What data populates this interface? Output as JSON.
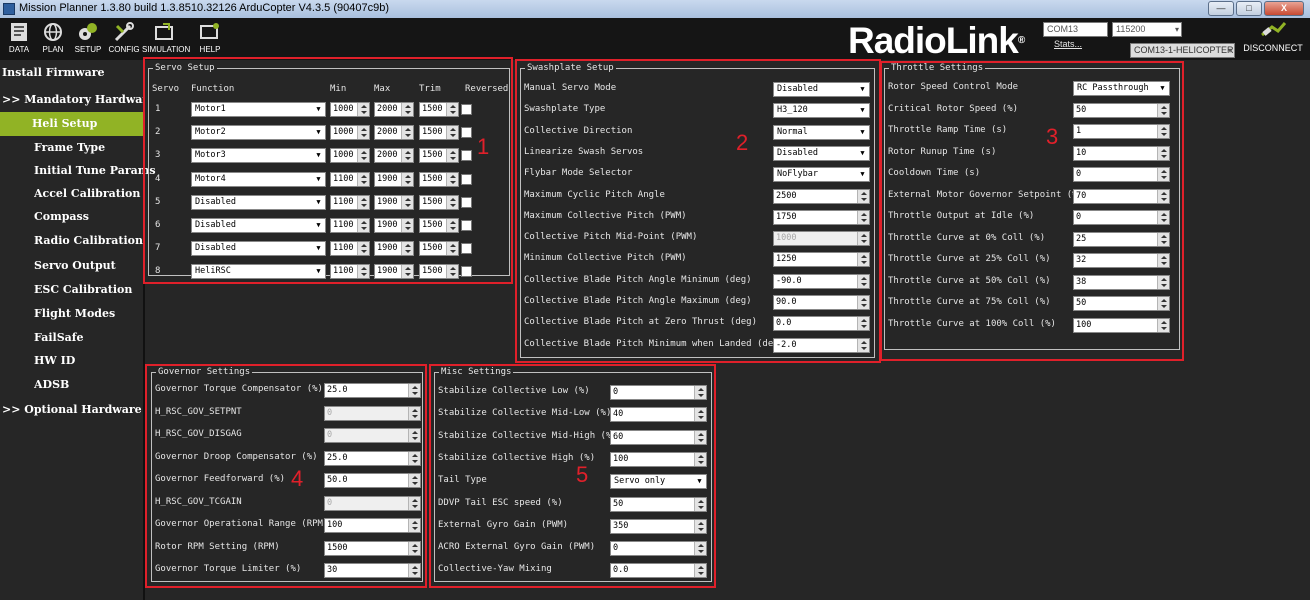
{
  "window": {
    "title": "Mission Planner 1.3.80 build 1.3.8510.32126 ArduCopter V4.3.5 (90407c9b)",
    "controls": [
      "—",
      "□",
      "X"
    ]
  },
  "toolbar": {
    "items": [
      {
        "label": "DATA",
        "icon": "data-icon"
      },
      {
        "label": "PLAN",
        "icon": "globe-icon"
      },
      {
        "label": "SETUP",
        "icon": "setup-icon"
      },
      {
        "label": "CONFIG",
        "icon": "config-icon"
      },
      {
        "label": "SIMULATION",
        "icon": "simulation-icon"
      },
      {
        "label": "HELP",
        "icon": "help-icon"
      }
    ],
    "brand": "RadioLink",
    "brand_mark": "®",
    "port": "COM13",
    "baud": "115200",
    "stats": "Stats...",
    "link": "COM13-1-HELICOPTER",
    "disconnect": "DISCONNECT",
    "accent_color": "#91b325"
  },
  "sidebar": {
    "items": [
      "Install Firmware",
      ">> Mandatory Hardware",
      "Heli Setup",
      "Frame Type",
      "Initial Tune Params",
      "Accel Calibration",
      "Compass",
      "Radio Calibration",
      "Servo Output",
      "ESC Calibration",
      "Flight Modes",
      "FailSafe",
      "HW ID",
      "ADSB",
      ">> Optional Hardware"
    ]
  },
  "servo_setup": {
    "title": "Servo Setup",
    "headers": {
      "servo": "Servo",
      "function": "Function",
      "min": "Min",
      "max": "Max",
      "trim": "Trim",
      "reversed": "Reversed"
    },
    "rows": [
      {
        "servo": "1",
        "function": "Motor1",
        "min": "1000",
        "max": "2000",
        "trim": "1500"
      },
      {
        "servo": "2",
        "function": "Motor2",
        "min": "1000",
        "max": "2000",
        "trim": "1500"
      },
      {
        "servo": "3",
        "function": "Motor3",
        "min": "1000",
        "max": "2000",
        "trim": "1500"
      },
      {
        "servo": "4",
        "function": "Motor4",
        "min": "1100",
        "max": "1900",
        "trim": "1500"
      },
      {
        "servo": "5",
        "function": "Disabled",
        "min": "1100",
        "max": "1900",
        "trim": "1500"
      },
      {
        "servo": "6",
        "function": "Disabled",
        "min": "1100",
        "max": "1900",
        "trim": "1500"
      },
      {
        "servo": "7",
        "function": "Disabled",
        "min": "1100",
        "max": "1900",
        "trim": "1500"
      },
      {
        "servo": "8",
        "function": "HeliRSC",
        "min": "1100",
        "max": "1900",
        "trim": "1500"
      }
    ]
  },
  "swashplate": {
    "title": "Swashplate Setup",
    "rows": [
      {
        "label": "Manual Servo Mode",
        "value": "Disabled",
        "kind": "dropdown"
      },
      {
        "label": "Swashplate Type",
        "value": "H3_120",
        "kind": "dropdown"
      },
      {
        "label": "Collective Direction",
        "value": "Normal",
        "kind": "dropdown"
      },
      {
        "label": "Linearize Swash Servos",
        "value": "Disabled",
        "kind": "dropdown"
      },
      {
        "label": "Flybar Mode Selector",
        "value": "NoFlybar",
        "kind": "dropdown"
      },
      {
        "label": "Maximum Cyclic Pitch Angle",
        "value": "2500",
        "kind": "num"
      },
      {
        "label": "Maximum Collective Pitch (PWM)",
        "value": "1750",
        "kind": "num"
      },
      {
        "label": "Collective Pitch Mid-Point (PWM)",
        "value": "1000",
        "kind": "num-disabled"
      },
      {
        "label": "Minimum Collective Pitch (PWM)",
        "value": "1250",
        "kind": "num"
      },
      {
        "label": "Collective Blade Pitch Angle Minimum (deg)",
        "value": "-90.0",
        "kind": "num"
      },
      {
        "label": "Collective Blade Pitch Angle Maximum (deg)",
        "value": "90.0",
        "kind": "num"
      },
      {
        "label": "Collective Blade Pitch at Zero Thrust (deg)",
        "value": "0.0",
        "kind": "num"
      },
      {
        "label": "Collective Blade Pitch Minimum when Landed (deg)",
        "value": "-2.0",
        "kind": "num"
      }
    ]
  },
  "throttle": {
    "title": "Throttle Settings",
    "rows": [
      {
        "label": "Rotor Speed Control Mode",
        "value": "RC Passthrough",
        "kind": "dropdown"
      },
      {
        "label": "Critical Rotor Speed (%)",
        "value": "50",
        "kind": "num"
      },
      {
        "label": "Throttle Ramp Time (s)",
        "value": "1",
        "kind": "num"
      },
      {
        "label": "Rotor Runup Time (s)",
        "value": "10",
        "kind": "num"
      },
      {
        "label": "Cooldown Time (s)",
        "value": "0",
        "kind": "num"
      },
      {
        "label": "External Motor Governor Setpoint (%)",
        "value": "70",
        "kind": "num"
      },
      {
        "label": "Throttle Output at Idle (%)",
        "value": "0",
        "kind": "num"
      },
      {
        "label": "Throttle Curve at 0% Coll (%)",
        "value": "25",
        "kind": "num"
      },
      {
        "label": "Throttle Curve at 25% Coll (%)",
        "value": "32",
        "kind": "num"
      },
      {
        "label": "Throttle Curve at 50% Coll (%)",
        "value": "38",
        "kind": "num"
      },
      {
        "label": "Throttle Curve at 75% Coll (%)",
        "value": "50",
        "kind": "num"
      },
      {
        "label": "Throttle Curve at 100% Coll (%)",
        "value": "100",
        "kind": "num"
      }
    ]
  },
  "governor": {
    "title": "Governor Settings",
    "rows": [
      {
        "label": "Governor Torque Compensator (%)",
        "value": "25.0",
        "kind": "num"
      },
      {
        "label": "H_RSC_GOV_SETPNT",
        "value": "0",
        "kind": "num-disabled"
      },
      {
        "label": "H_RSC_GOV_DISGAG",
        "value": "0",
        "kind": "num-disabled"
      },
      {
        "label": "Governor Droop Compensator (%)",
        "value": "25.0",
        "kind": "num"
      },
      {
        "label": "Governor Feedforward (%)",
        "value": "50.0",
        "kind": "num"
      },
      {
        "label": "H_RSC_GOV_TCGAIN",
        "value": "0",
        "kind": "num-disabled"
      },
      {
        "label": "Governor Operational Range (RPM)",
        "value": "100",
        "kind": "num"
      },
      {
        "label": "Rotor RPM Setting (RPM)",
        "value": "1500",
        "kind": "num"
      },
      {
        "label": "Governor Torque Limiter (%)",
        "value": "30",
        "kind": "num"
      }
    ]
  },
  "misc": {
    "title": "Misc Settings",
    "rows": [
      {
        "label": "Stabilize Collective Low (%)",
        "value": "0",
        "kind": "num"
      },
      {
        "label": "Stabilize Collective Mid-Low (%)",
        "value": "40",
        "kind": "num"
      },
      {
        "label": "Stabilize Collective Mid-High (%)",
        "value": "60",
        "kind": "num"
      },
      {
        "label": "Stabilize Collective High (%)",
        "value": "100",
        "kind": "num"
      },
      {
        "label": "Tail Type",
        "value": "Servo only",
        "kind": "dropdown"
      },
      {
        "label": "DDVP Tail ESC speed (%)",
        "value": "50",
        "kind": "num"
      },
      {
        "label": "External Gyro Gain (PWM)",
        "value": "350",
        "kind": "num"
      },
      {
        "label": "ACRO External Gyro Gain (PWM)",
        "value": "0",
        "kind": "num"
      },
      {
        "label": "Collective-Yaw Mixing",
        "value": "0.0",
        "kind": "num"
      }
    ]
  },
  "annotations": [
    "1",
    "2",
    "3",
    "4",
    "5"
  ],
  "annotation_color": "#e0202a"
}
